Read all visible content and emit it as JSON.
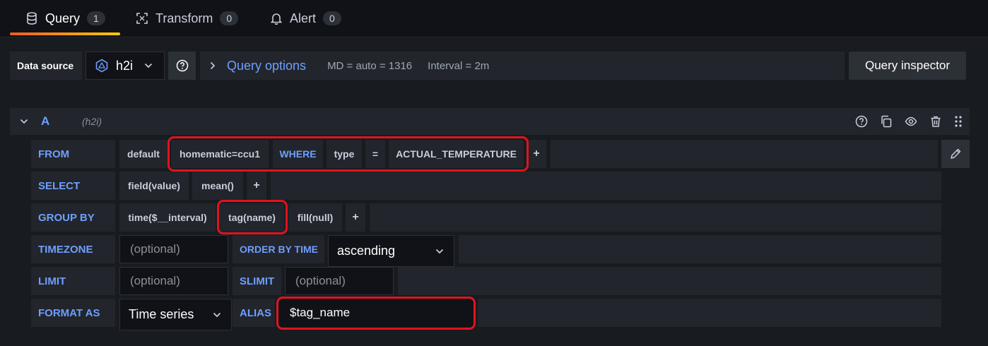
{
  "tabs": [
    {
      "label": "Query",
      "count": "1",
      "icon": "database-icon"
    },
    {
      "label": "Transform",
      "count": "0",
      "icon": "transform-icon"
    },
    {
      "label": "Alert",
      "count": "0",
      "icon": "bell-icon"
    }
  ],
  "toolbar": {
    "datasource_label": "Data source",
    "datasource_value": "h2i",
    "query_options_label": "Query options",
    "md": "MD = auto = 1316",
    "interval": "Interval = 2m",
    "inspector_label": "Query inspector"
  },
  "query": {
    "ref": "A",
    "source": "(h2i)",
    "from": {
      "label": "FROM",
      "policy": "default",
      "measurement": "homematic=ccu1",
      "where_kw": "WHERE",
      "tag_key": "type",
      "operator": "=",
      "tag_value": "ACTUAL_TEMPERATURE",
      "plus": "+"
    },
    "select": {
      "label": "SELECT",
      "field": "field(value)",
      "fn": "mean()",
      "plus": "+"
    },
    "group_by": {
      "label": "GROUP BY",
      "time": "time($__interval)",
      "tag": "tag(name)",
      "fill": "fill(null)",
      "plus": "+"
    },
    "timezone": {
      "label": "TIMEZONE",
      "placeholder": "(optional)",
      "order_label": "ORDER BY TIME",
      "order_value": "ascending"
    },
    "limit": {
      "label": "LIMIT",
      "placeholder": "(optional)",
      "slimit_label": "SLIMIT",
      "slimit_placeholder": "(optional)"
    },
    "format": {
      "label": "FORMAT AS",
      "value": "Time series",
      "alias_label": "ALIAS",
      "alias_value": "$tag_name"
    }
  },
  "colors": {
    "accent": "#6e9fff",
    "highlight": "#e0141e",
    "background": "#111217"
  }
}
